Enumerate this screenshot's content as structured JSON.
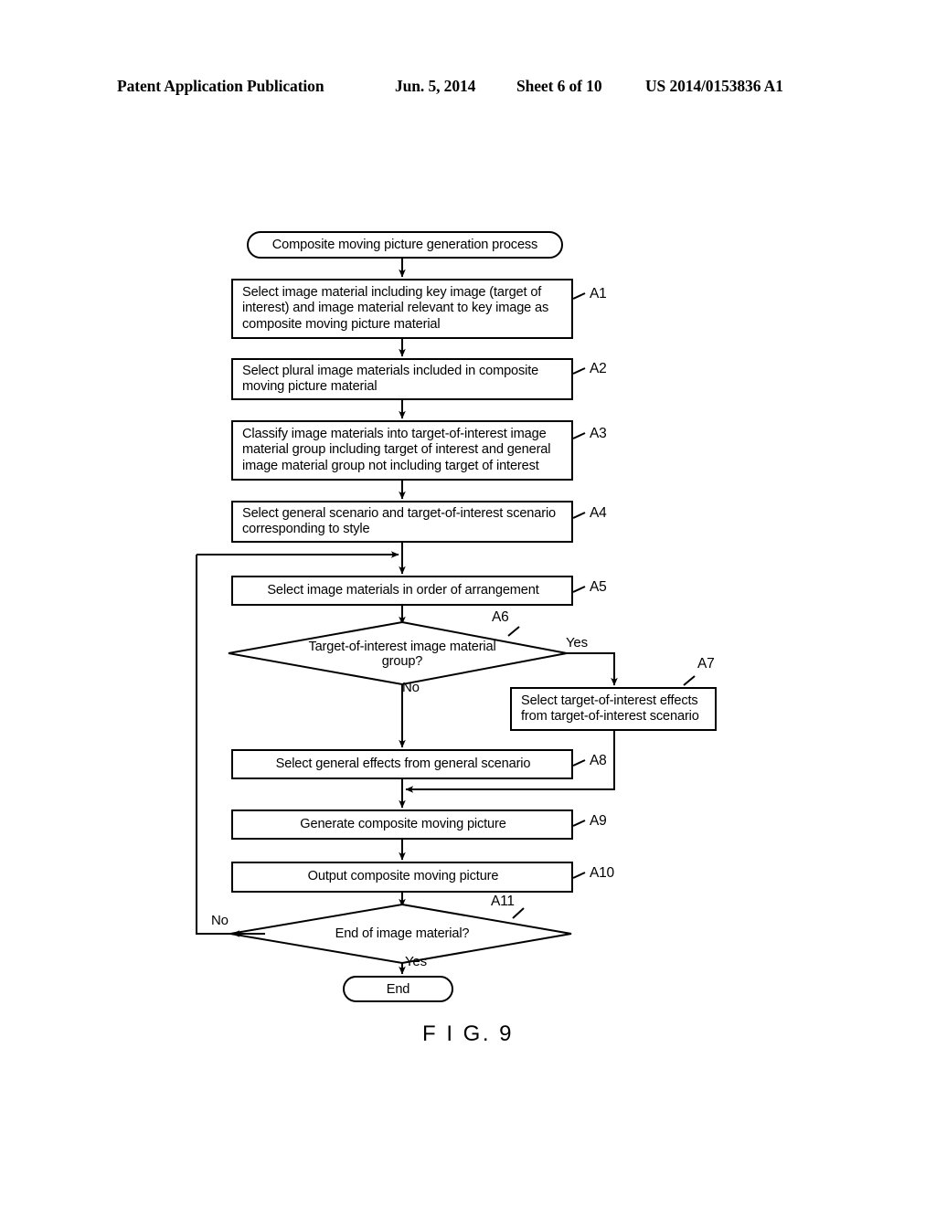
{
  "header": {
    "publication": "Patent Application Publication",
    "date": "Jun. 5, 2014",
    "sheet": "Sheet 6 of 10",
    "patent_number": "US 2014/0153836 A1"
  },
  "figure": {
    "caption": "F I G. 9"
  },
  "flowchart": {
    "start": {
      "label": "Composite moving picture generation process"
    },
    "end": {
      "label": "End"
    },
    "steps": [
      {
        "ref": "A1",
        "text": "Select image material including key image (target of interest) and image material relevant to key image as composite moving picture material"
      },
      {
        "ref": "A2",
        "text": "Select plural image materials included in composite moving picture material"
      },
      {
        "ref": "A3",
        "text": "Classify image materials into target-of-interest image material group including target of interest and general image material group not including target of interest"
      },
      {
        "ref": "A4",
        "text": "Select general scenario and target-of-interest scenario corresponding to style"
      },
      {
        "ref": "A5",
        "text": "Select image materials in order of arrangement"
      },
      {
        "ref": "A7",
        "text": "Select target-of-interest effects from target-of-interest scenario"
      },
      {
        "ref": "A8",
        "text": "Select general effects from general scenario"
      },
      {
        "ref": "A9",
        "text": "Generate composite moving picture"
      },
      {
        "ref": "A10",
        "text": "Output composite moving picture"
      }
    ],
    "decisions": [
      {
        "ref": "A6",
        "text": "Target-of-interest image material group?",
        "yes_label": "Yes",
        "no_label": "No"
      },
      {
        "ref": "A11",
        "text": "End of image material?",
        "yes_label": "Yes",
        "no_label": "No"
      }
    ]
  }
}
